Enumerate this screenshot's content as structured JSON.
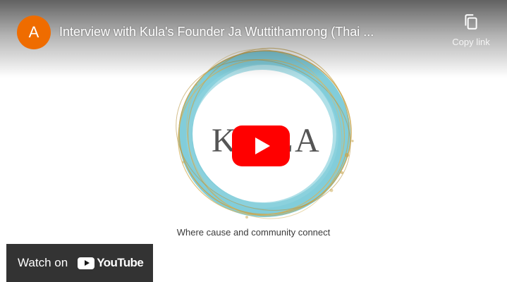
{
  "video": {
    "channel_avatar_letter": "A",
    "title": "Interview with Kula's Founder Ja Wuttithamrong (Thai ...",
    "copy_link_label": "Copy link",
    "copy_link_icon": "copy-icon",
    "play_icon": "play-icon"
  },
  "thumbnail": {
    "logo_text_left": "K",
    "logo_text_mid": "U L",
    "logo_text_right": "A",
    "tagline": "Where cause and community connect"
  },
  "watch_on": {
    "label": "Watch on",
    "brand": "YouTube",
    "icon": "youtube-logo-icon"
  },
  "colors": {
    "avatar": "#ef6c00",
    "play_button": "#ff0000",
    "ring_blue": "#6cc4d4",
    "ring_gold": "#c9a54c",
    "watch_on_bg": "#171717"
  }
}
